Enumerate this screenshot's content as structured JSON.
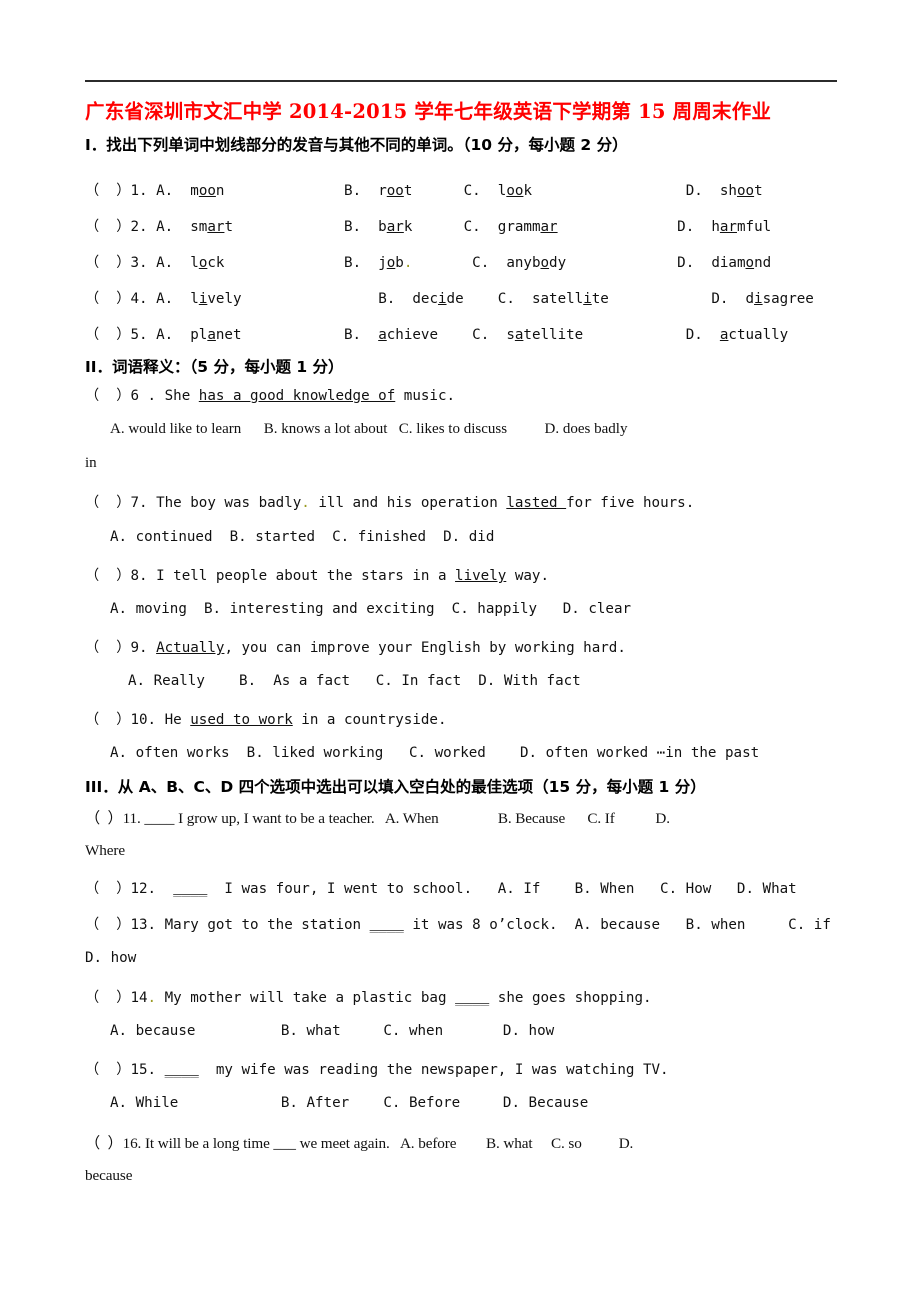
{
  "document": {
    "title": "广东省深圳市文汇中学 2014-2015 学年七年级英语下学期第 15 周周末作业",
    "title_color": "#FF0000"
  },
  "sections": [
    {
      "id": "section-1",
      "heading": "I．找出下列单词中划线部分的发音与其他不同的单词。（10 分，每小题 2 分）",
      "questions": [
        {
          "num": "1",
          "prefix": "（  ）1. ",
          "options": "A.  moon              B.  root      C.  look                  D.  shoot"
        },
        {
          "num": "2",
          "prefix": "（  ）2. ",
          "options": "A.  smart             B.  bark      C.  grammar              D.  harmful"
        },
        {
          "num": "3",
          "prefix": "（  ）3. ",
          "options": "A.  lock              B.  job.       C.  anybody             D.  diamond"
        },
        {
          "num": "4",
          "prefix": "（  ）4. ",
          "options": "A.  lively                B.  decide    C.  satellite            D.  disagree"
        },
        {
          "num": "5",
          "prefix": "（  ）5. ",
          "options": "A.  planet            B.  achieve    C.  satellite            D.  actually"
        }
      ]
    },
    {
      "id": "section-2",
      "heading": "II．词语释义：（5 分，每小题 1 分）",
      "questions": [
        {
          "num": "6",
          "stem": "（  ）6 . She has a good knowledge of music.",
          "options": "A. would like to learn      B. knows a lot about   C. likes to discuss          D. does badly",
          "options_wrap": "in"
        },
        {
          "num": "7",
          "stem": "（  ）7. The boy was badly. ill and his operation lasted for five hours.",
          "options": "A. continued  B. started  C. finished  D. did"
        },
        {
          "num": "8",
          "stem": "（  ）8. I tell people about the stars in a lively way.",
          "options": "A. moving  B. interesting and exciting  C. happily   D. clear"
        },
        {
          "num": "9",
          "stem": "（  ）9. Actually, you can improve your English by working hard.",
          "options": "A. Really    B.  As a fact   C. In fact  D. With fact"
        },
        {
          "num": "10",
          "stem": "（  ）10. He used to work in a countryside.",
          "options": "A. often works  B. liked working   C. worked    D. often worked ⋯in the past"
        }
      ]
    },
    {
      "id": "section-3",
      "heading": "III．从 A、B、C、D 四个选项中选出可以填入空白处的最佳选项（15 分，每小题 1 分）",
      "questions": [
        {
          "num": "11",
          "stem": "（  ）11. ____ I grow up, I want to be a teacher.   A. When                B. Because      C. If           D.",
          "stem_wrap": "Where"
        },
        {
          "num": "12",
          "stem": "（  ）12.  ____  I was four, I went to school.   A. If    B. When   C. How   D. What"
        },
        {
          "num": "13",
          "stem": "（  ）13. Mary got to the station ____ it was 8 o’clock.  A. because   B. when     C. if",
          "stem_wrap": "D. how"
        },
        {
          "num": "14",
          "stem": "（  ）14. My mother will take a plastic bag ____ she goes shopping.",
          "options": "A. because          B. what     C. when       D. how"
        },
        {
          "num": "15",
          "stem": "（  ）15. ____  my wife was reading the newspaper, I was watching TV.",
          "options": "A. While            B. After    C. Before     D. Because"
        },
        {
          "num": "16",
          "stem": "（  ）16. It will be a long time ___ we meet again.   A. before        B. what     C. so          D.",
          "stem_wrap": "because"
        }
      ]
    }
  ]
}
